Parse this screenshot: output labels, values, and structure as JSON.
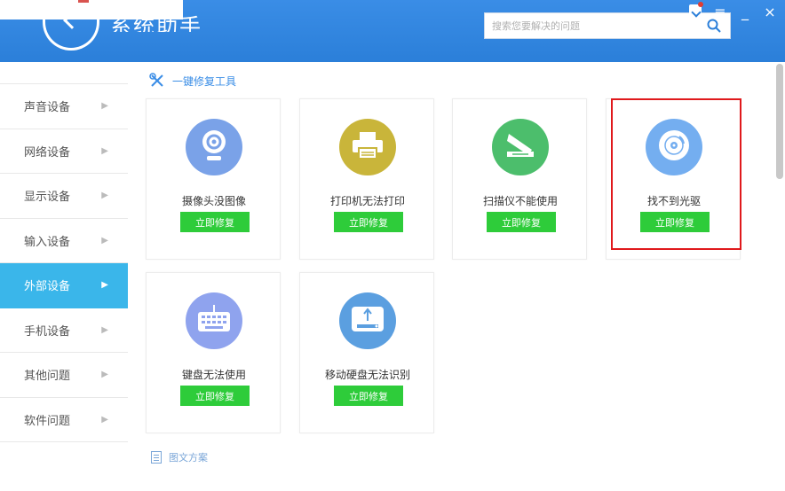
{
  "header": {
    "title": "系统助手",
    "search_placeholder": "搜索您要解决的问题"
  },
  "window": {
    "menu_symbol": "≡",
    "minimize_symbol": "_",
    "close_symbol": "×"
  },
  "sidebar": {
    "items": [
      {
        "label": "声音设备",
        "active": false
      },
      {
        "label": "网络设备",
        "active": false
      },
      {
        "label": "显示设备",
        "active": false
      },
      {
        "label": "输入设备",
        "active": false
      },
      {
        "label": "外部设备",
        "active": true
      },
      {
        "label": "手机设备",
        "active": false
      },
      {
        "label": "其他问题",
        "active": false
      },
      {
        "label": "软件问题",
        "active": false
      }
    ],
    "chevron": "▶"
  },
  "main": {
    "section_title": "一键修复工具",
    "cards": [
      {
        "label": "摄像头没图像",
        "button": "立即修复",
        "icon": "webcam-icon",
        "color": "#7aa2e8"
      },
      {
        "label": "打印机无法打印",
        "button": "立即修复",
        "icon": "printer-icon",
        "color": "#c9b53a"
      },
      {
        "label": "扫描仪不能使用",
        "button": "立即修复",
        "icon": "scanner-icon",
        "color": "#4cbe6c"
      },
      {
        "label": "找不到光驱",
        "button": "立即修复",
        "icon": "disc-icon",
        "color": "#74aef0"
      },
      {
        "label": "键盘无法使用",
        "button": "立即修复",
        "icon": "keyboard-icon",
        "color": "#8fa3ee"
      },
      {
        "label": "移动硬盘无法识别",
        "button": "立即修复",
        "icon": "usb-drive-icon",
        "color": "#5b9fe0"
      }
    ],
    "footer_link": "图文方案"
  },
  "colors": {
    "header": "#2b7fd9",
    "active_sidebar": "#3ab6ea",
    "fix_button": "#2ecc3a",
    "highlight": "#e0191c"
  }
}
